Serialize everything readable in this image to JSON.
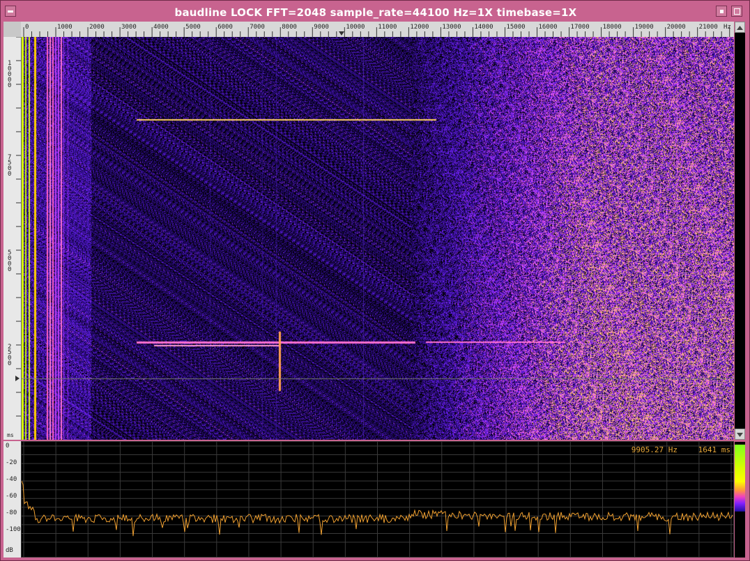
{
  "window": {
    "title": "baudline  LOCK FFT=2048 sample_rate=44100 Hz=1X timebase=1X"
  },
  "freq_axis": {
    "ticks": [
      "0",
      "1000",
      "2000",
      "3000",
      "4000",
      "5000",
      "6000",
      "7000",
      "8000",
      "9000",
      "10000",
      "11000",
      "12000",
      "13000",
      "14000",
      "15000",
      "16000",
      "17000",
      "18000",
      "19000",
      "20000",
      "21000"
    ],
    "unit": "Hz"
  },
  "time_axis": {
    "ticks": [
      "10000",
      "7500",
      "5000",
      "2500"
    ],
    "unit": "ms"
  },
  "spectrum": {
    "db_ticks": [
      "0",
      "-20",
      "-40",
      "-60",
      "-80",
      "-100"
    ],
    "db_unit": "dB",
    "readout_freq": "9905.27 Hz",
    "readout_time": "1641 ms"
  },
  "colors": {
    "trace": "#f0a030",
    "noise_low": "#3a10a0",
    "noise_high": "#ff78ff",
    "tone": "#d7ff00"
  }
}
